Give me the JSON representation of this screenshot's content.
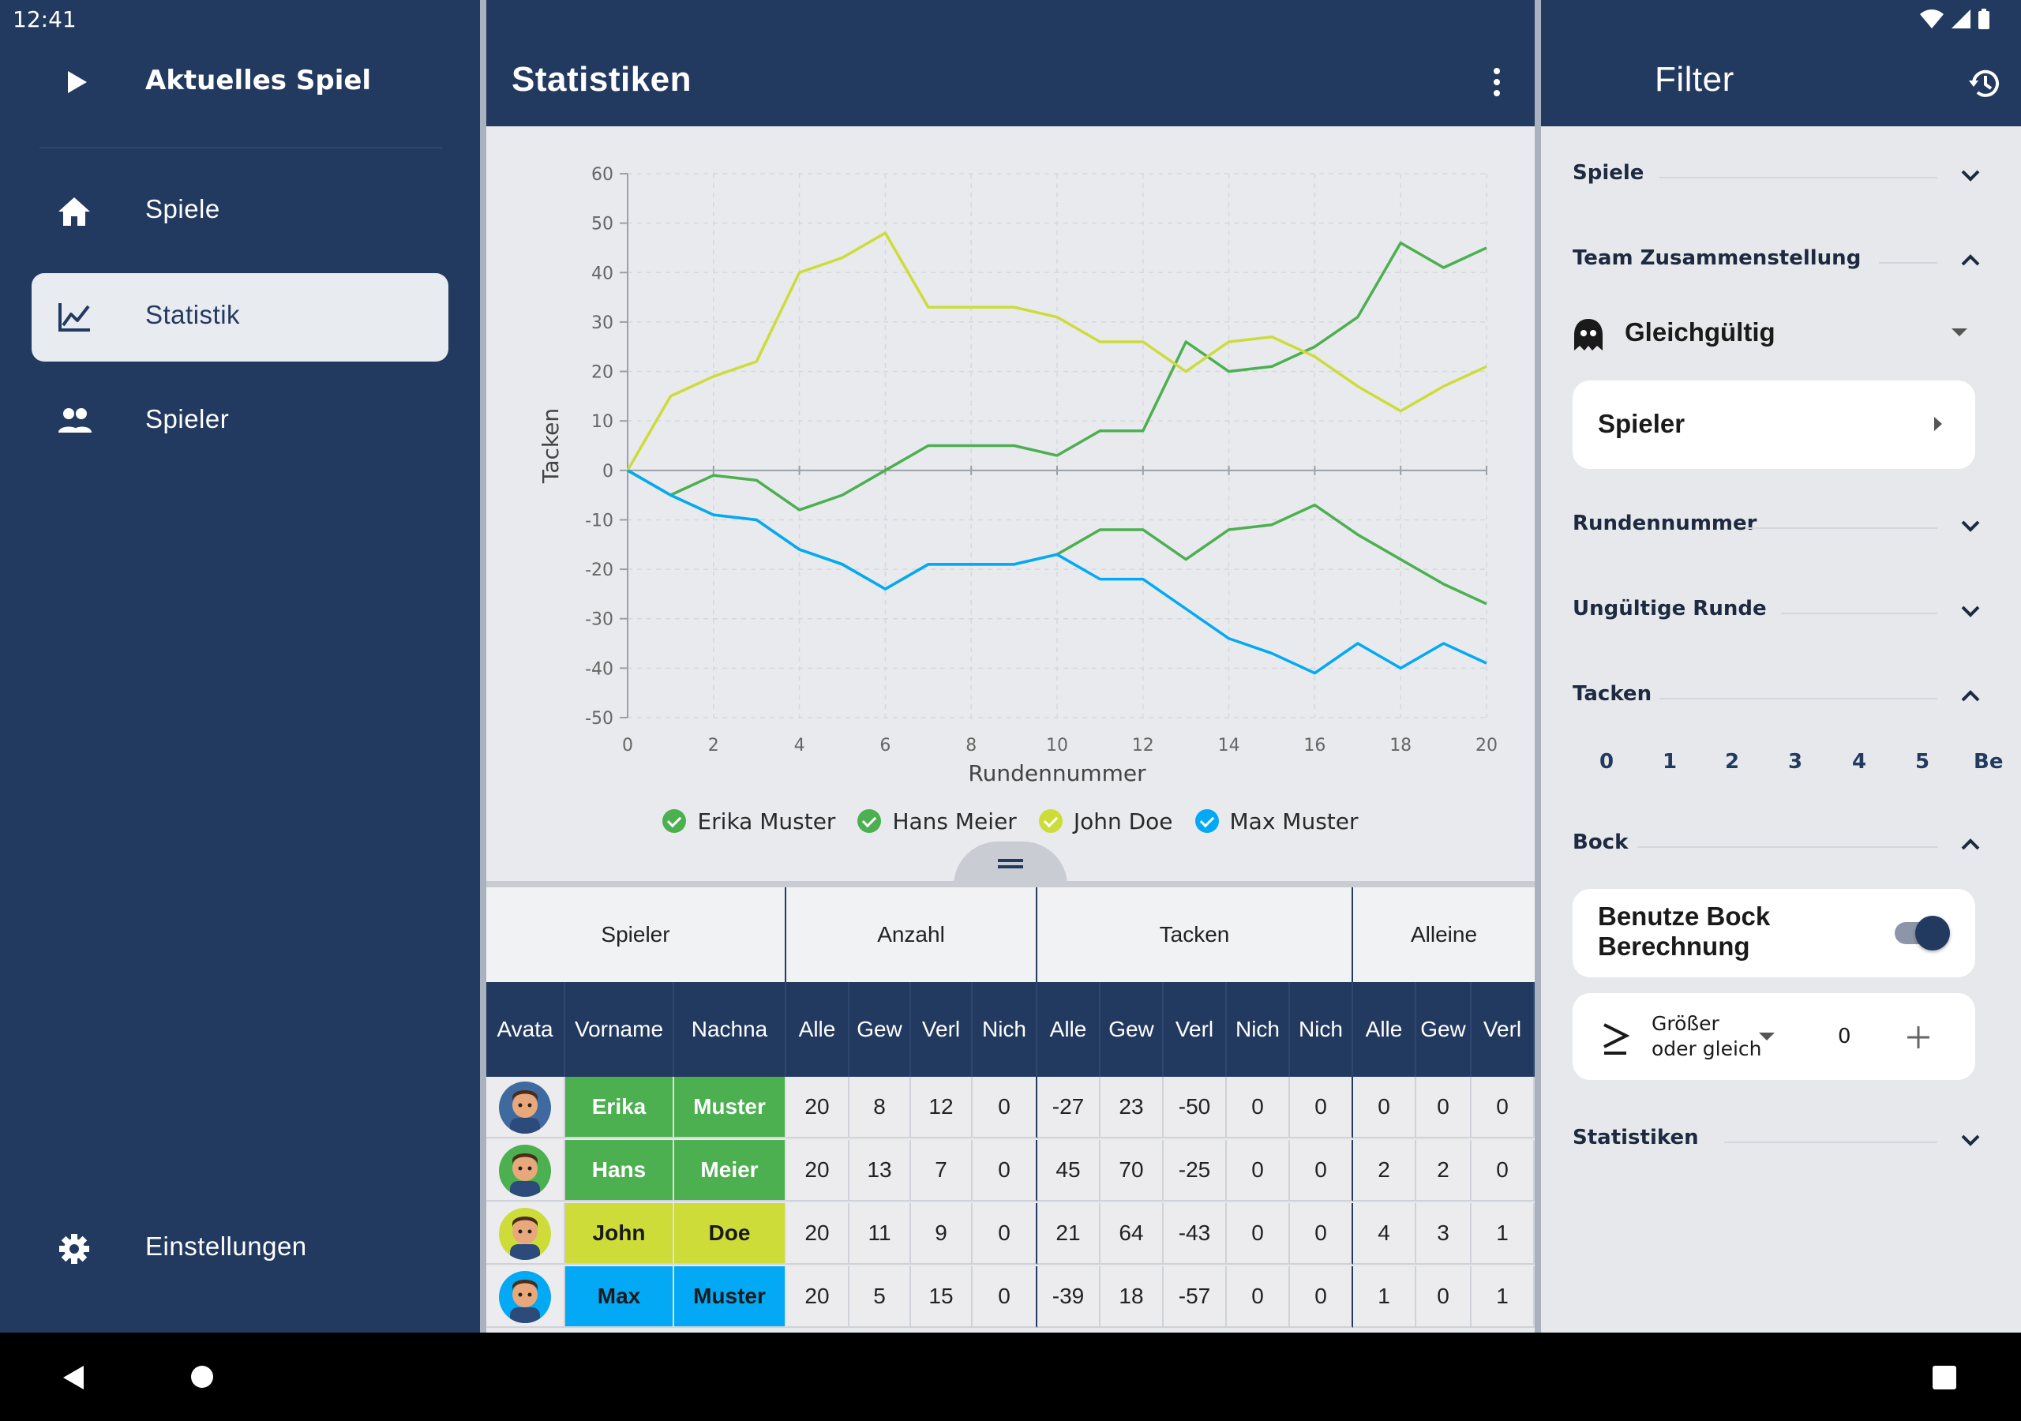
{
  "status": {
    "time": "12:41"
  },
  "nav": {
    "current_game": "Aktuelles Spiel",
    "items": [
      {
        "label": "Spiele",
        "icon": "home-icon"
      },
      {
        "label": "Statistik",
        "icon": "chart-icon",
        "active": true
      },
      {
        "label": "Spieler",
        "icon": "people-icon"
      }
    ],
    "settings": "Einstellungen"
  },
  "center": {
    "title": "Statistiken"
  },
  "chart_data": {
    "type": "line",
    "xlabel": "Rundennummer",
    "ylabel": "Tacken",
    "xlim": [
      0,
      20
    ],
    "ylim": [
      -50,
      60
    ],
    "x_ticks": [
      0,
      2,
      4,
      6,
      8,
      10,
      12,
      14,
      16,
      18,
      20
    ],
    "y_ticks": [
      60,
      50,
      40,
      30,
      20,
      10,
      0,
      -10,
      -20,
      -30,
      -40,
      -50
    ],
    "x": [
      0,
      1,
      2,
      3,
      4,
      5,
      6,
      7,
      8,
      9,
      10,
      11,
      12,
      13,
      14,
      15,
      16,
      17,
      18,
      19,
      20
    ],
    "series": [
      {
        "name": "Erika Muster",
        "color": "#4caf50",
        "values": [
          0,
          -5,
          -9,
          -10,
          -16,
          -19,
          -24,
          -19,
          -19,
          -19,
          -17,
          -12,
          -12,
          -18,
          -12,
          -11,
          -7,
          -13,
          -18,
          -23,
          -27
        ]
      },
      {
        "name": "Hans Meier",
        "color": "#4caf50",
        "values": [
          0,
          -5,
          -1,
          -2,
          -8,
          -5,
          0,
          5,
          5,
          5,
          3,
          8,
          8,
          26,
          20,
          21,
          25,
          31,
          46,
          41,
          45
        ]
      },
      {
        "name": "John Doe",
        "color": "#cddc39",
        "values": [
          0,
          15,
          19,
          22,
          40,
          43,
          48,
          33,
          33,
          33,
          31,
          26,
          26,
          20,
          26,
          27,
          23,
          17,
          12,
          17,
          21
        ]
      },
      {
        "name": "Max Muster",
        "color": "#03a9f4",
        "values": [
          0,
          -5,
          -9,
          -10,
          -16,
          -19,
          -24,
          -19,
          -19,
          -19,
          -17,
          -22,
          -22,
          -28,
          -34,
          -37,
          -41,
          -35,
          -40,
          -35,
          -39
        ]
      }
    ],
    "legend_position": "bottom",
    "grid": true
  },
  "table": {
    "groups": [
      "Spieler",
      "Anzahl",
      "Tacken",
      "Alleine"
    ],
    "headers": [
      "Avata",
      "Vorname",
      "Nachna",
      "Alle",
      "Gew",
      "Verl",
      "Nich",
      "Alle",
      "Gew",
      "Verl",
      "Nich",
      "Nich",
      "Alle",
      "Gew",
      "Verl"
    ],
    "rows": [
      {
        "first": "Erika",
        "last": "Muster",
        "color": "#4caf50",
        "dark": false,
        "avatar_bg": "#3f6aa0",
        "values": [
          "20",
          "8",
          "12",
          "0",
          "-27",
          "23",
          "-50",
          "0",
          "0",
          "0",
          "0",
          "0"
        ]
      },
      {
        "first": "Hans",
        "last": "Meier",
        "color": "#4caf50",
        "dark": false,
        "avatar_bg": "#4caf50",
        "values": [
          "20",
          "13",
          "7",
          "0",
          "45",
          "70",
          "-25",
          "0",
          "0",
          "2",
          "2",
          "0"
        ]
      },
      {
        "first": "John",
        "last": "Doe",
        "color": "#cddc39",
        "dark": true,
        "avatar_bg": "#cddc39",
        "values": [
          "20",
          "11",
          "9",
          "0",
          "21",
          "64",
          "-43",
          "0",
          "0",
          "4",
          "3",
          "1"
        ]
      },
      {
        "first": "Max",
        "last": "Muster",
        "color": "#03a9f4",
        "dark": true,
        "avatar_bg": "#03a9f4",
        "values": [
          "20",
          "5",
          "15",
          "0",
          "-39",
          "18",
          "-57",
          "0",
          "0",
          "1",
          "0",
          "1"
        ]
      }
    ]
  },
  "filter": {
    "title": "Filter",
    "sections": {
      "spiele": "Spiele",
      "team": "Team Zusammenstellung",
      "runde": "Rundennummer",
      "ungueltig": "Ungültige Runde",
      "tacken": "Tacken",
      "bock": "Bock",
      "statistiken": "Statistiken"
    },
    "team_select": "Gleichgültig",
    "spieler_card": "Spieler",
    "tacken_values": [
      "0",
      "1",
      "2",
      "3",
      "4",
      "5",
      "Be"
    ],
    "bock_toggle_label": "Benutze Bock Berechnung",
    "bock_toggle_on": true,
    "compare_label_1": "Größer",
    "compare_label_2": "oder gleich",
    "compare_value": "0"
  }
}
